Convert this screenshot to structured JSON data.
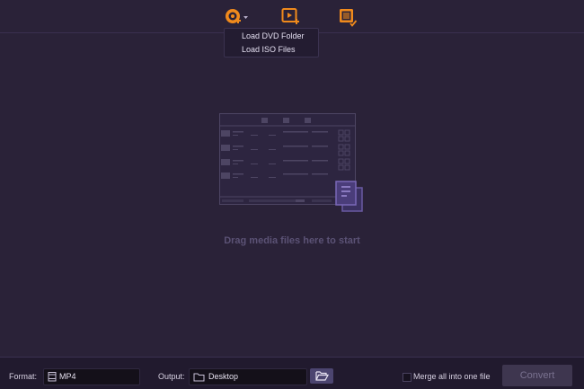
{
  "toolbar": {
    "load_disc_icon": "disc-plus-icon",
    "add_files_icon": "video-plus-icon",
    "toolbox_icon": "toolbox-icon",
    "dropdown": {
      "items": [
        "Load DVD Folder",
        "Load ISO Files"
      ]
    }
  },
  "main": {
    "drop_hint": "Drag media files here to start"
  },
  "bottom": {
    "format_label": "Format:",
    "format_value": "MP4",
    "output_label": "Output:",
    "output_value": "Desktop",
    "merge_label": "Merge all into one file",
    "merge_checked": false,
    "convert_label": "Convert"
  },
  "colors": {
    "background": "#2a2238",
    "accent_orange": "#f08a1c",
    "bottom_bar": "#211a2e",
    "drop_text": "#5b5275"
  }
}
